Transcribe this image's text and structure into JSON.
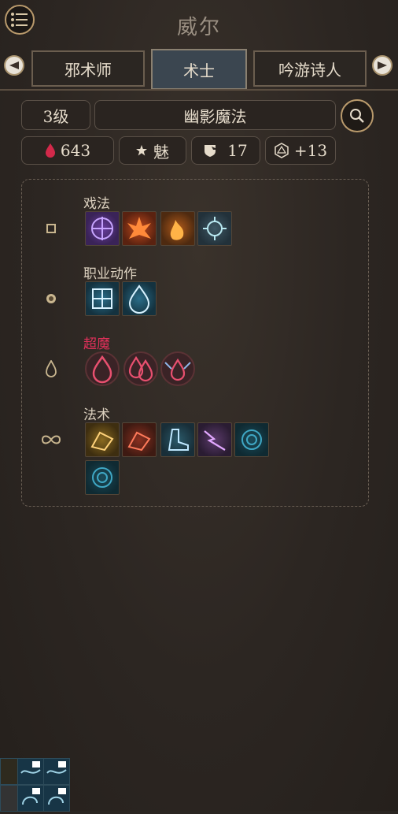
{
  "header": {
    "title": "威尔"
  },
  "tabs": [
    {
      "label": "邪术师"
    },
    {
      "label": "术士"
    },
    {
      "label": "吟游诗人"
    }
  ],
  "filters": {
    "level": "3级",
    "subclass": "幽影魔法"
  },
  "stats": {
    "hp": "643",
    "ability": "魅",
    "ac": "17",
    "bonus": "+13"
  },
  "categories": [
    {
      "label": "戏法"
    },
    {
      "label": "职业动作"
    },
    {
      "label": "超魔"
    },
    {
      "label": "法术"
    }
  ],
  "colors": {
    "accent_gold": "#b99a6c",
    "metamagic_red": "#e0305a",
    "hp_red": "#d2294a"
  }
}
